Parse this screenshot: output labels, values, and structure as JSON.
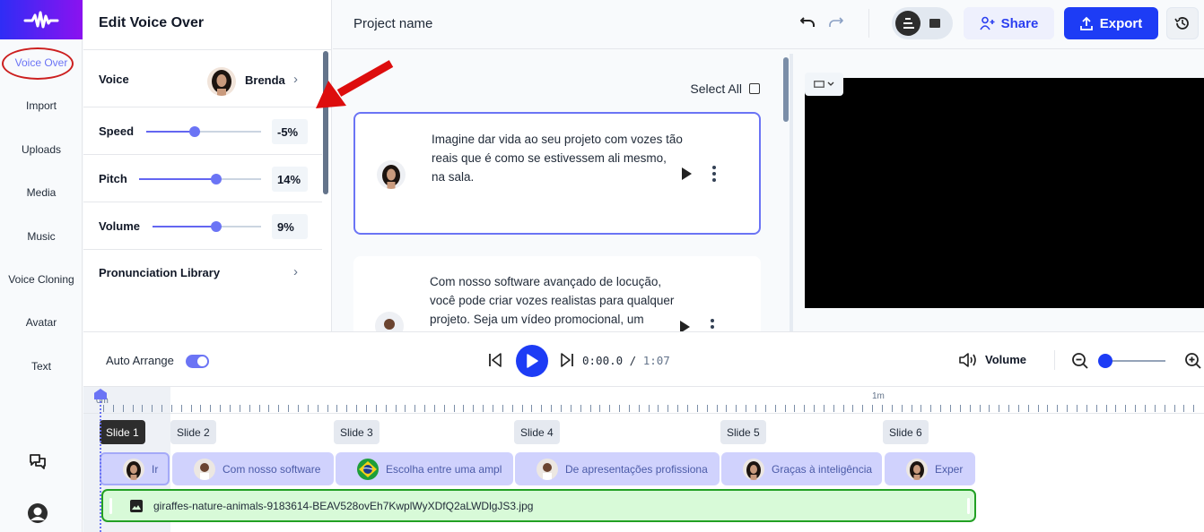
{
  "nav": {
    "items": [
      {
        "label": "Voice Over",
        "active": true
      },
      {
        "label": "Import"
      },
      {
        "label": "Uploads"
      },
      {
        "label": "Media"
      },
      {
        "label": "Music"
      },
      {
        "label": "Voice Cloning"
      },
      {
        "label": "Avatar"
      },
      {
        "label": "Text"
      }
    ],
    "bottom_icons": [
      "chat-icon",
      "user-avatar-icon"
    ]
  },
  "edit_panel": {
    "title": "Edit Voice Over",
    "voice": {
      "label": "Voice",
      "name": "Brenda"
    },
    "sliders": [
      {
        "label": "Speed",
        "value_text": "-5%",
        "fraction": 0.42
      },
      {
        "label": "Pitch",
        "value_text": "14%",
        "fraction": 0.63
      },
      {
        "label": "Volume",
        "value_text": "9%",
        "fraction": 0.59
      }
    ],
    "pronunciation": {
      "label": "Pronunciation Library"
    }
  },
  "topbar": {
    "project_name": "Project name",
    "share_label": "Share",
    "export_label": "Export"
  },
  "script": {
    "select_all_label": "Select All",
    "cards": [
      {
        "text": "Imagine dar vida ao seu projeto com vozes tão reais que é como se estivessem ali mesmo, na sala.",
        "selected": true,
        "voice": "female"
      },
      {
        "text": "Com nosso software avançado de locução, você pode criar vozes realistas para qualquer projeto. Seja um vídeo promocional, um",
        "selected": false,
        "voice": "male"
      }
    ]
  },
  "controls": {
    "auto_arrange_label": "Auto Arrange",
    "auto_arrange_on": true,
    "current_time": "0:00.0",
    "separator": " / ",
    "total_time": "1:07",
    "volume_label": "Volume",
    "zoom_fraction": 0.0
  },
  "timeline": {
    "ruler_labels": [
      "0m",
      "1m"
    ],
    "slides": [
      {
        "label": "Slide 1",
        "active": true
      },
      {
        "label": "Slide 2"
      },
      {
        "label": "Slide 3"
      },
      {
        "label": "Slide 4"
      },
      {
        "label": "Slide 5"
      },
      {
        "label": "Slide 6"
      }
    ],
    "clips": [
      {
        "text": "Ir",
        "voice": "female"
      },
      {
        "text": "Com nosso software",
        "voice": "male"
      },
      {
        "text": "Escolha entre uma ampl",
        "voice": "brazil-flag"
      },
      {
        "text": "De apresentações profissiona",
        "voice": "male"
      },
      {
        "text": "Graças à inteligência",
        "voice": "female"
      },
      {
        "text": "Exper",
        "voice": "female"
      }
    ],
    "image_track": {
      "filename": "giraffes-nature-animals-9183614-BEAV528ovEh7KwplWyXDfQ2aLWDlgJS3.jpg"
    }
  },
  "colors": {
    "accent": "#1d3cf5",
    "selection": "#6b74f5",
    "clip_bg": "#d0d2fd",
    "image_track_bg": "#d8fad8",
    "image_track_border": "#22a024",
    "annotation": "#cc1f1f"
  }
}
